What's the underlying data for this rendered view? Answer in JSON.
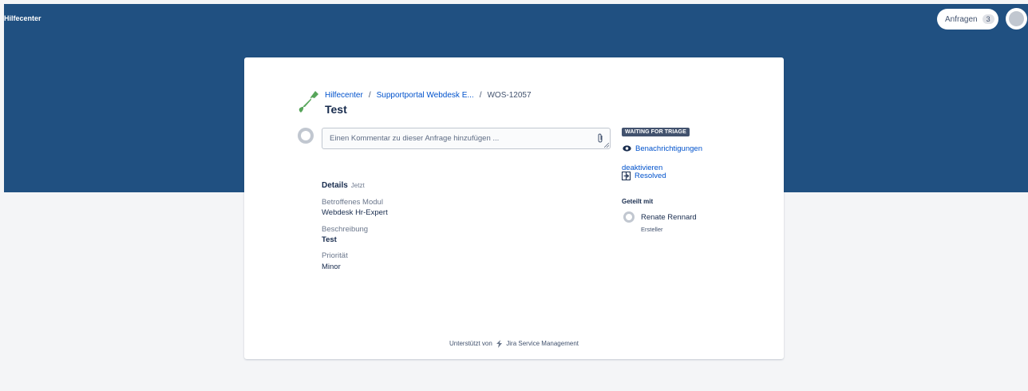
{
  "header": {
    "brand": "Hilfecenter",
    "requests_label": "Anfragen",
    "requests_count": "3"
  },
  "breadcrumb": {
    "home": "Hilfecenter",
    "portal": "Supportportal Webdesk E...",
    "issue_key": "WOS-12057"
  },
  "request": {
    "title": "Test",
    "comment_placeholder": "Einen Kommentar zu dieser Anfrage hinzufügen ..."
  },
  "details": {
    "heading": "Details",
    "time": "Jetzt",
    "fields": [
      {
        "label": "Betroffenes Modul",
        "value": "Webdesk Hr-Expert"
      },
      {
        "label": "Beschreibung",
        "value": "Test"
      },
      {
        "label": "Priorität",
        "value": "Minor"
      }
    ]
  },
  "sidebar": {
    "status": "WAITING FOR TRIAGE",
    "notifications_label": "Benachrichtigungen deaktivieren",
    "resolve_label": "Resolved",
    "shared_heading": "Geteilt mit",
    "shared_name": "Renate Rennard",
    "shared_role": "Ersteller"
  },
  "footer": {
    "prefix": "Unterstützt von",
    "product": "Jira Service Management"
  },
  "colors": {
    "header_bg": "#205081",
    "link": "#0052cc",
    "status_bg": "#42526e",
    "icon_green": "#57a55a"
  }
}
